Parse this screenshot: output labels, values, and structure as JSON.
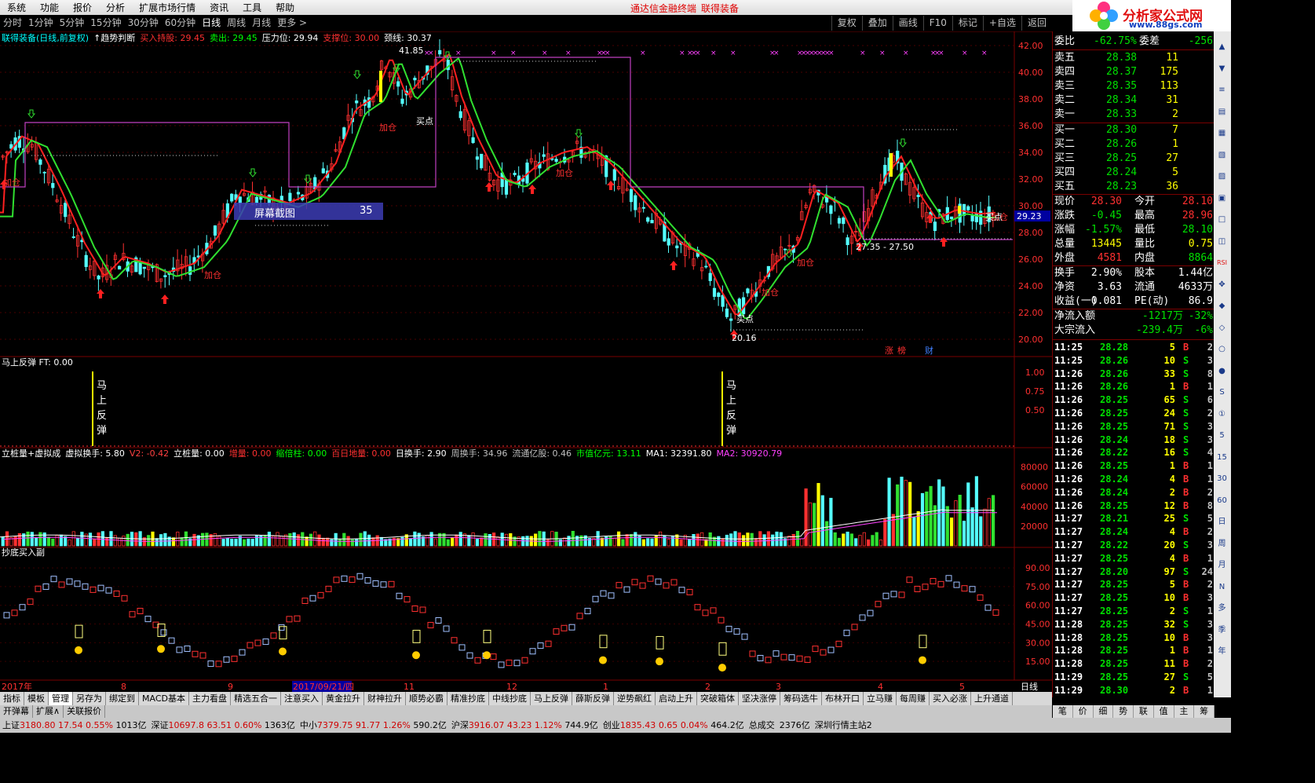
{
  "menu": {
    "items": [
      "系统",
      "功能",
      "报价",
      "分析",
      "扩展市场行情",
      "资讯",
      "工具",
      "帮助"
    ],
    "center_left": "通达信金融终端",
    "center_right": "联得装备"
  },
  "logo": {
    "title": "分析家公式网",
    "url": "www.88gs.com"
  },
  "timeframes": [
    "分时",
    "1分钟",
    "5分钟",
    "15分钟",
    "30分钟",
    "60分钟",
    "日线",
    "周线",
    "月线",
    "更多 >"
  ],
  "active_timeframe": "日线",
  "toolbar_right": [
    "复权",
    "叠加",
    "画线",
    "F10",
    "标记",
    "+自选",
    "返回"
  ],
  "main_panel": {
    "info_items": [
      {
        "text": "联得装备(日线,前复权)",
        "color": "#00ffff"
      },
      {
        "text": "↑趋势判断",
        "color": "#ffffff"
      },
      {
        "text": "买入持股: 29.45",
        "color": "#ff3030"
      },
      {
        "text": "卖出: 29.45",
        "color": "#00ff00"
      },
      {
        "text": "压力位: 29.94",
        "color": "#ffffff"
      },
      {
        "text": "支撑位: 30.00",
        "color": "#ff3030"
      },
      {
        "text": "颈线: 30.37",
        "color": "#ffffff"
      }
    ],
    "price_ticks": [
      "42.00",
      "40.00",
      "38.00",
      "36.00",
      "34.00",
      "32.00",
      "30.00",
      "28.00",
      "26.00",
      "24.00",
      "22.00",
      "20.00"
    ],
    "current_price_tag": "29.23",
    "annotations": {
      "high": "41.85",
      "low": "20.16",
      "range": "27.35 - 27.50",
      "add": "加仓",
      "buy": "买点",
      "add_left": "加仓"
    },
    "bottom_labels": [
      "涨",
      "榜",
      "财"
    ]
  },
  "screenshot_popup": {
    "label": "屏幕截图",
    "value": "35"
  },
  "rebound_panel": {
    "title": "马上反弹  FT: 0.00",
    "ticks": [
      "1.00",
      "0.75",
      "0.50"
    ],
    "markers": [
      "马",
      "上",
      "反",
      "弹"
    ]
  },
  "volume_panel": {
    "info_items": [
      {
        "text": "立桩量+虚拟成",
        "color": "#ffffff"
      },
      {
        "text": "虚拟换手: 5.80",
        "color": "#ffffff"
      },
      {
        "text": "V2: -0.42",
        "color": "#ff4040"
      },
      {
        "text": "立桩量: 0.00",
        "color": "#ffffff"
      },
      {
        "text": "增量: 0.00",
        "color": "#ff3030"
      },
      {
        "text": "缩倍柱: 0.00",
        "color": "#00ff00"
      },
      {
        "text": "百日地量: 0.00",
        "color": "#ff3030"
      },
      {
        "text": "日换手: 2.90",
        "color": "#ffffff"
      },
      {
        "text": "周换手: 34.96",
        "color": "#c0c0c0"
      },
      {
        "text": "流通亿股: 0.46",
        "color": "#c0c0c0"
      },
      {
        "text": "市值亿元: 13.11",
        "color": "#00ff00"
      },
      {
        "text": "MA1: 32391.80",
        "color": "#ffffff"
      },
      {
        "text": "MA2: 30920.79",
        "color": "#ff40ff"
      }
    ],
    "ticks": [
      "80000",
      "60000",
      "40000",
      "20000"
    ]
  },
  "bottom_panel": {
    "title": "抄底买入副",
    "ticks": [
      "90.00",
      "75.00",
      "60.00",
      "45.00",
      "30.00",
      "15.00"
    ]
  },
  "date_axis": {
    "labels": [
      "2017年",
      "8",
      "9",
      "2017/09/21/四",
      "11",
      "12",
      "1",
      "2",
      "3",
      "4",
      "5"
    ],
    "right": "日线"
  },
  "quote": {
    "weibi": {
      "label": "委比",
      "value": "-62.75%",
      "extra_label": "委差",
      "extra_value": "-256"
    },
    "sell": [
      {
        "label": "卖五",
        "price": "28.38",
        "vol": "11"
      },
      {
        "label": "卖四",
        "price": "28.37",
        "vol": "175"
      },
      {
        "label": "卖三",
        "price": "28.35",
        "vol": "113"
      },
      {
        "label": "卖二",
        "price": "28.34",
        "vol": "31"
      },
      {
        "label": "卖一",
        "price": "28.33",
        "vol": "2"
      }
    ],
    "buy": [
      {
        "label": "买一",
        "price": "28.30",
        "vol": "7"
      },
      {
        "label": "买二",
        "price": "28.26",
        "vol": "1"
      },
      {
        "label": "买三",
        "price": "28.25",
        "vol": "27"
      },
      {
        "label": "买四",
        "price": "28.24",
        "vol": "5"
      },
      {
        "label": "买五",
        "price": "28.23",
        "vol": "36"
      }
    ],
    "stats": [
      {
        "l1": "现价",
        "v1": "28.30",
        "c1": "#ff3030",
        "l2": "今开",
        "v2": "28.10",
        "c2": "#ff3030"
      },
      {
        "l1": "涨跌",
        "v1": "-0.45",
        "c1": "#00e000",
        "l2": "最高",
        "v2": "28.96",
        "c2": "#ff3030"
      },
      {
        "l1": "涨幅",
        "v1": "-1.57%",
        "c1": "#00e000",
        "l2": "最低",
        "v2": "28.10",
        "c2": "#00e000"
      },
      {
        "l1": "总量",
        "v1": "13445",
        "c1": "#ffff00",
        "l2": "量比",
        "v2": "0.75",
        "c2": "#ffff00"
      },
      {
        "l1": "外盘",
        "v1": "4581",
        "c1": "#ff3030",
        "l2": "内盘",
        "v2": "8864",
        "c2": "#00e000"
      }
    ],
    "stats2": [
      {
        "l1": "换手",
        "v1": "2.90%",
        "c1": "#ffffff",
        "l2": "股本",
        "v2": "1.44亿",
        "c2": "#ffffff"
      },
      {
        "l1": "净资",
        "v1": "3.63",
        "c1": "#ffffff",
        "l2": "流通",
        "v2": "4633万",
        "c2": "#ffffff"
      },
      {
        "l1": "收益(一)",
        "v1": "0.081",
        "c1": "#ffffff",
        "l2": "PE(动)",
        "v2": "86.9",
        "c2": "#ffffff"
      }
    ],
    "flows": [
      {
        "label": "净流入额",
        "value": "-1217万",
        "pct": "-32%"
      },
      {
        "label": "大宗流入",
        "value": "-239.4万",
        "pct": "-6%"
      }
    ],
    "ticks": [
      {
        "t": "11:25",
        "p": "28.28",
        "v": "5",
        "d": "B",
        "n": "2"
      },
      {
        "t": "11:25",
        "p": "28.26",
        "v": "10",
        "d": "S",
        "n": "3"
      },
      {
        "t": "11:26",
        "p": "28.26",
        "v": "33",
        "d": "S",
        "n": "8"
      },
      {
        "t": "11:26",
        "p": "28.26",
        "v": "1",
        "d": "B",
        "n": "1"
      },
      {
        "t": "11:26",
        "p": "28.25",
        "v": "65",
        "d": "S",
        "n": "6"
      },
      {
        "t": "11:26",
        "p": "28.25",
        "v": "24",
        "d": "S",
        "n": "2"
      },
      {
        "t": "11:26",
        "p": "28.25",
        "v": "71",
        "d": "S",
        "n": "3"
      },
      {
        "t": "11:26",
        "p": "28.24",
        "v": "18",
        "d": "S",
        "n": "3"
      },
      {
        "t": "11:26",
        "p": "28.22",
        "v": "16",
        "d": "S",
        "n": "4"
      },
      {
        "t": "11:26",
        "p": "28.25",
        "v": "1",
        "d": "B",
        "n": "1"
      },
      {
        "t": "11:26",
        "p": "28.24",
        "v": "4",
        "d": "B",
        "n": "1"
      },
      {
        "t": "11:26",
        "p": "28.24",
        "v": "2",
        "d": "B",
        "n": "2"
      },
      {
        "t": "11:26",
        "p": "28.25",
        "v": "12",
        "d": "B",
        "n": "8"
      },
      {
        "t": "11:27",
        "p": "28.21",
        "v": "25",
        "d": "S",
        "n": "5"
      },
      {
        "t": "11:27",
        "p": "28.24",
        "v": "4",
        "d": "B",
        "n": "2"
      },
      {
        "t": "11:27",
        "p": "28.22",
        "v": "20",
        "d": "S",
        "n": "3"
      },
      {
        "t": "11:27",
        "p": "28.25",
        "v": "4",
        "d": "B",
        "n": "1"
      },
      {
        "t": "11:27",
        "p": "28.20",
        "v": "97",
        "d": "S",
        "n": "24"
      },
      {
        "t": "11:27",
        "p": "28.25",
        "v": "5",
        "d": "B",
        "n": "2"
      },
      {
        "t": "11:27",
        "p": "28.25",
        "v": "10",
        "d": "B",
        "n": "3"
      },
      {
        "t": "11:27",
        "p": "28.25",
        "v": "2",
        "d": "S",
        "n": "1"
      },
      {
        "t": "11:28",
        "p": "28.25",
        "v": "32",
        "d": "S",
        "n": "3"
      },
      {
        "t": "11:28",
        "p": "28.25",
        "v": "10",
        "d": "B",
        "n": "3"
      },
      {
        "t": "11:28",
        "p": "28.25",
        "v": "1",
        "d": "B",
        "n": "1"
      },
      {
        "t": "11:28",
        "p": "28.25",
        "v": "11",
        "d": "B",
        "n": "2"
      },
      {
        "t": "11:29",
        "p": "28.25",
        "v": "27",
        "d": "S",
        "n": "5"
      },
      {
        "t": "11:29",
        "p": "28.30",
        "v": "2",
        "d": "B",
        "n": "1"
      }
    ],
    "bottom_tabs": [
      "笔",
      "价",
      "细",
      "势",
      "联",
      "值",
      "主",
      "筹"
    ]
  },
  "side_icons": [
    "▲",
    "▼",
    "≡",
    "▤",
    "▦",
    "▧",
    "▨",
    "▣",
    "□",
    "◫",
    "RSI",
    "✥",
    "◆",
    "◇",
    "○",
    "●",
    "S",
    "①",
    "5",
    "15",
    "30",
    "60",
    "日",
    "周",
    "月",
    "N",
    "多",
    "季",
    "年"
  ],
  "bottom_tabs": [
    "指标",
    "模板",
    "管理",
    "另存为",
    "绑定到",
    "MACD基本",
    "主力看盘",
    "精选五合一",
    "注意买入",
    "黄金拉升",
    "财神拉升",
    "顺势必霸",
    "精准抄底",
    "中线抄底",
    "马上反弹",
    "薛斯反弹",
    "逆势飙红",
    "启动上升",
    "突破箱体",
    "坚决涨停",
    "筹码选牛",
    "布林开口",
    "立马赚",
    "每周赚",
    "买入必涨",
    "上升通道"
  ],
  "active_bottom_tab": "管理",
  "tabs2": [
    "开弹幕",
    "扩展∧",
    "关联报价"
  ],
  "statusbar": [
    {
      "label": "上证",
      "v1": "3180.80",
      "v2": "17.54",
      "v3": "0.55%",
      "amt": "1013亿"
    },
    {
      "label": "深证",
      "v1": "10697.8",
      "v2": "63.51",
      "v3": "0.60%",
      "amt": "1363亿"
    },
    {
      "label": "中小",
      "v1": "7379.75",
      "v2": "91.77",
      "v3": "1.26%",
      "amt": "590.2亿"
    },
    {
      "label": "沪深",
      "v1": "3916.07",
      "v2": "43.23",
      "v3": "1.12%",
      "amt": "744.9亿"
    },
    {
      "label": "创业",
      "v1": "1835.43",
      "v2": "0.65",
      "v3": "0.04%",
      "amt": "464.2亿"
    }
  ],
  "status_extra": [
    "总成交",
    "2376亿",
    "深圳行情主站2"
  ],
  "colors": {
    "up": "#ff3030",
    "down": "#00ffff",
    "ma_red": "#ff2020",
    "ma_green": "#30e030",
    "grid": "#5a0000",
    "purple": "#c040c0"
  }
}
